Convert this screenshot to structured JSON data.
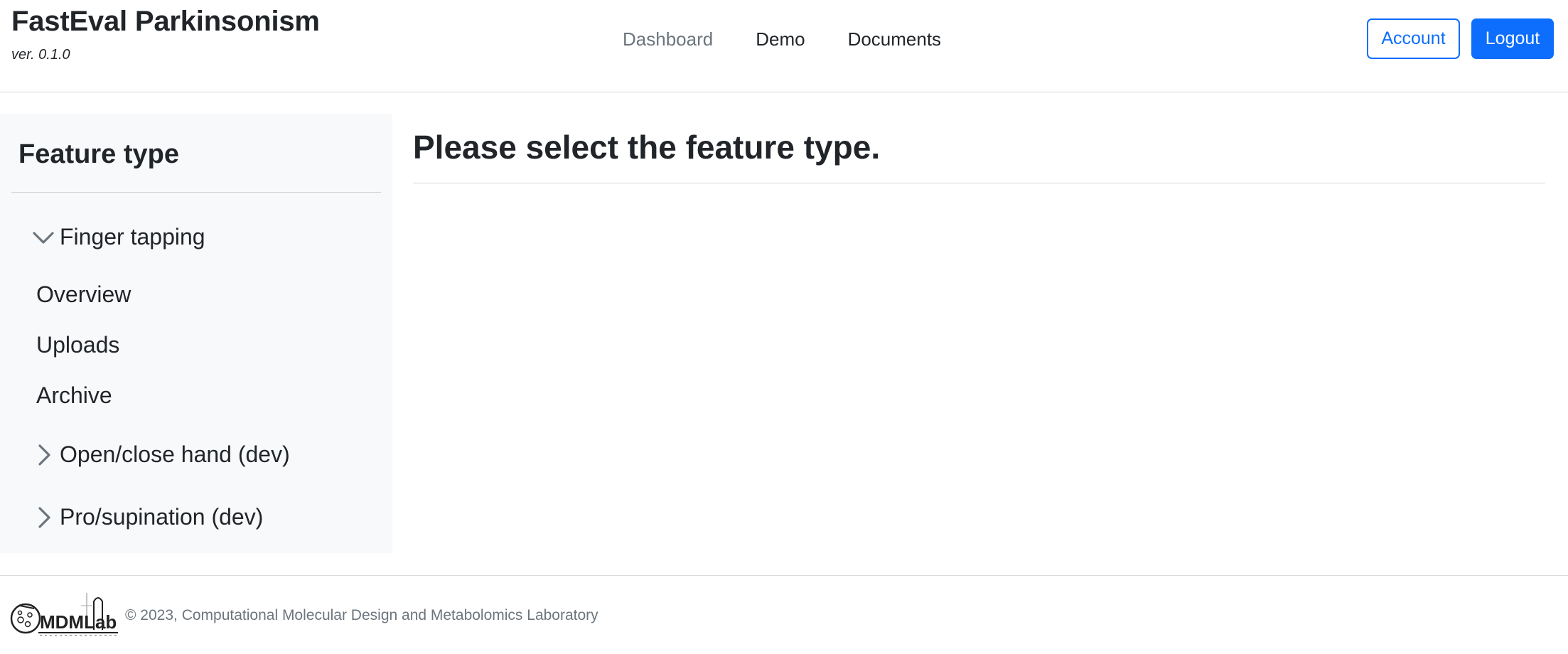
{
  "brand": {
    "title": "FastEval Parkinsonism",
    "version": "ver. 0.1.0"
  },
  "nav": {
    "items": [
      {
        "label": "Dashboard",
        "state": "muted"
      },
      {
        "label": "Demo",
        "state": "normal"
      },
      {
        "label": "Documents",
        "state": "normal"
      }
    ]
  },
  "auth": {
    "account_label": "Account",
    "logout_label": "Logout"
  },
  "sidebar": {
    "heading": "Feature type",
    "groups": [
      {
        "label": "Finger tapping",
        "expanded": true,
        "icon": "chevron-down-icon",
        "items": [
          {
            "label": "Overview"
          },
          {
            "label": "Uploads"
          },
          {
            "label": "Archive"
          }
        ]
      },
      {
        "label": "Open/close hand (dev)",
        "expanded": false,
        "icon": "chevron-right-icon"
      },
      {
        "label": "Pro/supination (dev)",
        "expanded": false,
        "icon": "chevron-right-icon"
      }
    ]
  },
  "main": {
    "title": "Please select the feature type."
  },
  "footer": {
    "logo_text": "MDMLab",
    "text": "© 2023, Computational Molecular Design and Metabolomics Laboratory"
  },
  "colors": {
    "primary": "#0d6efd",
    "muted": "#6c757d",
    "sidebar_bg": "#f8f9fa",
    "text": "#212529"
  }
}
